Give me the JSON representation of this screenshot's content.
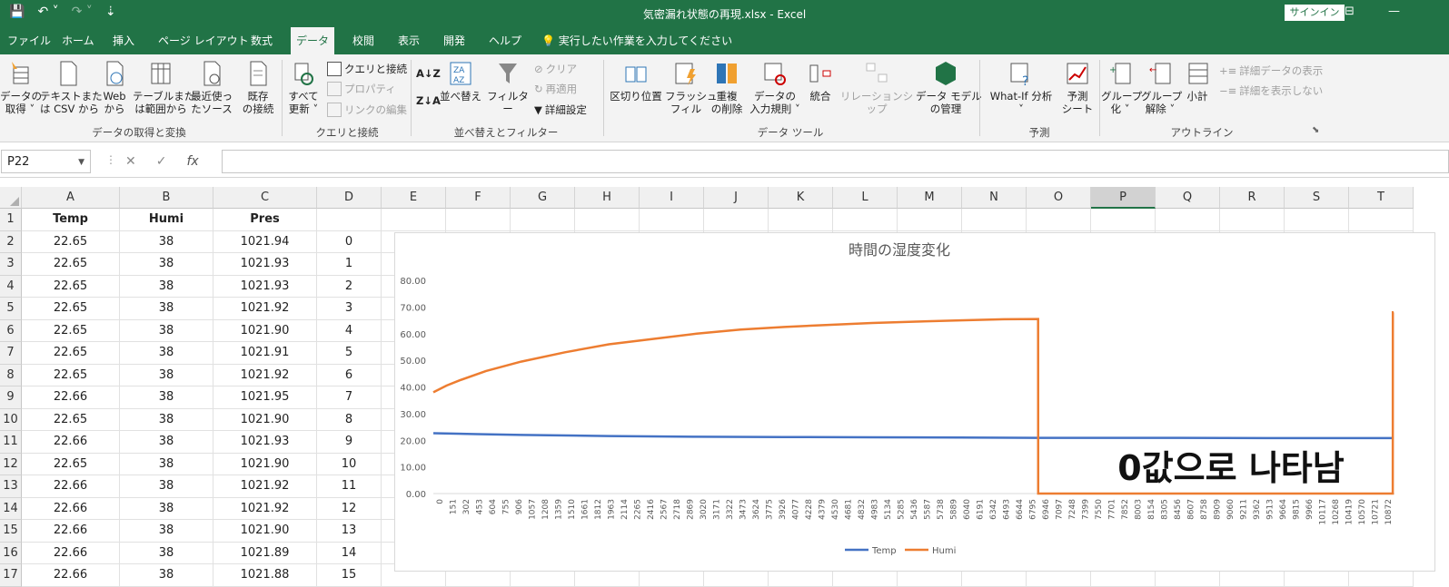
{
  "window": {
    "title": "気密漏れ状態の再現.xlsx  -  Excel",
    "signin": "サインイン"
  },
  "menu": [
    "ファイル",
    "ホーム",
    "挿入",
    "ページ レイアウト",
    "数式",
    "データ",
    "校閲",
    "表示",
    "開発",
    "ヘルプ",
    "実行したい作業を入力してください"
  ],
  "ribbon": {
    "get_data": "データの\n取得 ˅",
    "text_csv": "テキストまた\nは CSV から",
    "web": "Web\nから",
    "table": "テーブルまた\nは範囲から",
    "recent": "最近使っ\nたソース",
    "existing": "既存\nの接続",
    "refresh": "すべて\n更新 ˅",
    "queries": "クエリと接続",
    "properties": "プロパティ",
    "edit_links": "リンクの編集",
    "sort": "並べ替え",
    "filter": "フィルター",
    "clear": "クリア",
    "reapply": "再適用",
    "advanced": "詳細設定",
    "text_to_columns": "区切り位置",
    "flash_fill": "フラッシュ\nフィル",
    "remove_dup": "重複\nの削除",
    "validation": "データの\n入力規則 ˅",
    "consolidate": "統合",
    "relationships": "リレーションシップ",
    "data_model": "データ モデル\nの管理",
    "whatif": "What-If 分析\n˅",
    "forecast_sheet": "予測\nシート",
    "group": "グループ\n化 ˅",
    "ungroup": "グループ\n解除 ˅",
    "subtotal": "小計",
    "show_detail": "詳細データの表示",
    "hide_detail": "詳細を表示しない",
    "groups": {
      "get_transform": "データの取得と変換",
      "queries": "クエリと接続",
      "sort_filter": "並べ替えとフィルター",
      "data_tools": "データ ツール",
      "forecast": "予測",
      "outline": "アウトライン"
    }
  },
  "formula_bar": {
    "name_box": "P22",
    "fx": "fx",
    "value": ""
  },
  "columns": [
    "A",
    "B",
    "C",
    "D",
    "E",
    "F",
    "G",
    "H",
    "I",
    "J",
    "K",
    "L",
    "M",
    "N",
    "O",
    "P",
    "Q",
    "R",
    "S",
    "T"
  ],
  "selected_column": "P",
  "rows": [
    "1",
    "2",
    "3",
    "4",
    "5",
    "6",
    "7",
    "8",
    "9",
    "10",
    "11",
    "12",
    "13",
    "14",
    "15",
    "16",
    "17"
  ],
  "table": {
    "headers": [
      "Temp",
      "Humi",
      "Pres",
      ""
    ],
    "data": [
      [
        "22.65",
        "38",
        "1021.94",
        "0"
      ],
      [
        "22.65",
        "38",
        "1021.93",
        "1"
      ],
      [
        "22.65",
        "38",
        "1021.93",
        "2"
      ],
      [
        "22.65",
        "38",
        "1021.92",
        "3"
      ],
      [
        "22.65",
        "38",
        "1021.90",
        "4"
      ],
      [
        "22.65",
        "38",
        "1021.91",
        "5"
      ],
      [
        "22.65",
        "38",
        "1021.92",
        "6"
      ],
      [
        "22.66",
        "38",
        "1021.95",
        "7"
      ],
      [
        "22.65",
        "38",
        "1021.90",
        "8"
      ],
      [
        "22.66",
        "38",
        "1021.93",
        "9"
      ],
      [
        "22.65",
        "38",
        "1021.90",
        "10"
      ],
      [
        "22.66",
        "38",
        "1021.92",
        "11"
      ],
      [
        "22.66",
        "38",
        "1021.92",
        "12"
      ],
      [
        "22.66",
        "38",
        "1021.90",
        "13"
      ],
      [
        "22.66",
        "38",
        "1021.89",
        "14"
      ],
      [
        "22.66",
        "38",
        "1021.88",
        "15"
      ]
    ]
  },
  "chart_data": {
    "type": "line",
    "title": "時間の湿度変化",
    "annotation": "0값으로 나타남",
    "ylim": [
      0,
      80
    ],
    "yticks": [
      "0.00",
      "10.00",
      "20.00",
      "30.00",
      "40.00",
      "50.00",
      "60.00",
      "70.00",
      "80.00"
    ],
    "xticks": [
      "0",
      "151",
      "302",
      "453",
      "604",
      "755",
      "906",
      "1057",
      "1208",
      "1359",
      "1510",
      "1661",
      "1812",
      "1963",
      "2114",
      "2265",
      "2416",
      "2567",
      "2718",
      "2869",
      "3020",
      "3171",
      "3322",
      "3473",
      "3624",
      "3775",
      "3926",
      "4077",
      "4228",
      "4379",
      "4530",
      "4681",
      "4832",
      "4983",
      "5134",
      "5285",
      "5436",
      "5587",
      "5738",
      "5889",
      "6040",
      "6191",
      "6342",
      "6493",
      "6644",
      "6795",
      "6946",
      "7097",
      "7248",
      "7399",
      "7550",
      "7701",
      "7852",
      "8003",
      "8154",
      "8305",
      "8456",
      "8607",
      "8758",
      "8909",
      "9060",
      "9211",
      "9362",
      "9513",
      "9664",
      "9815",
      "9966",
      "10117",
      "10268",
      "10419",
      "10570",
      "10721",
      "10872"
    ],
    "xmax": 10950,
    "legend_position": "bottom",
    "series": [
      {
        "name": "Temp",
        "color": "#4472c4",
        "x": [
          0,
          500,
          1000,
          2000,
          3000,
          4000,
          5000,
          6000,
          6900,
          7500,
          8500,
          9500,
          10500,
          10940
        ],
        "y": [
          22.65,
          22.3,
          22.0,
          21.6,
          21.3,
          21.2,
          21.1,
          21.0,
          20.9,
          20.9,
          20.9,
          20.8,
          20.8,
          20.8
        ]
      },
      {
        "name": "Humi",
        "color": "#ed7d31",
        "x": [
          0,
          150,
          300,
          600,
          1000,
          1500,
          2000,
          2500,
          3000,
          3500,
          4000,
          4500,
          5000,
          5500,
          6000,
          6500,
          6890,
          6891,
          10930,
          10931,
          10940
        ],
        "y": [
          38,
          40.5,
          42.5,
          46,
          49.5,
          53,
          56,
          58,
          60,
          61.5,
          62.5,
          63.3,
          64,
          64.5,
          65,
          65.4,
          65.5,
          0,
          0,
          68,
          68
        ]
      }
    ]
  }
}
